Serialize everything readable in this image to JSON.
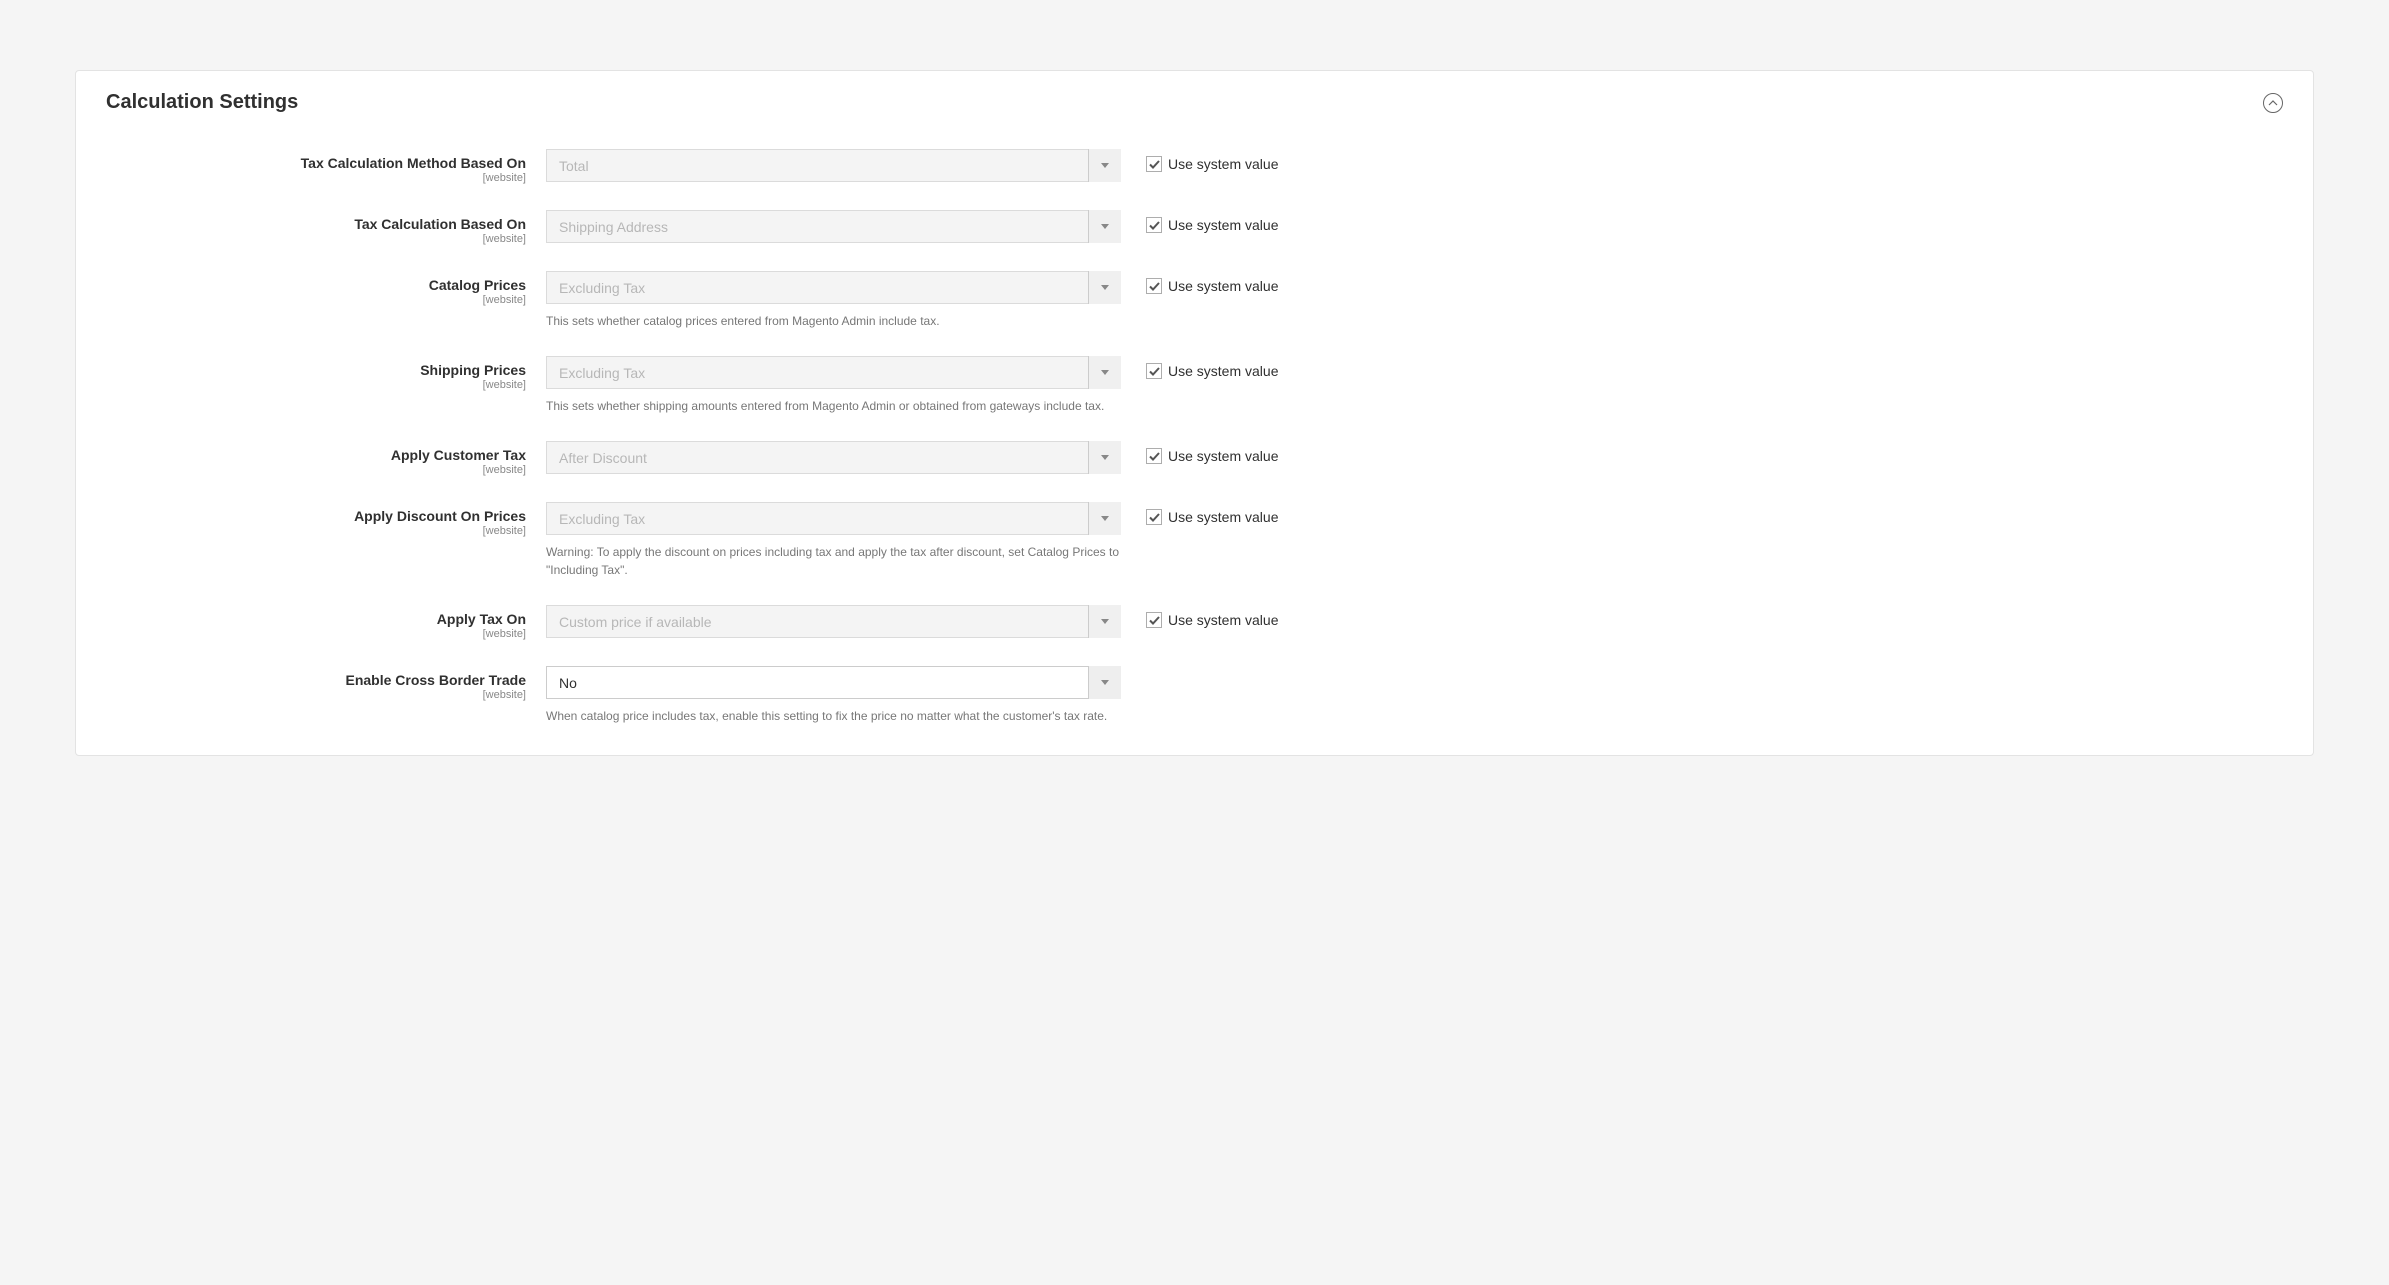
{
  "panel": {
    "title": "Calculation Settings",
    "use_system_value_label": "Use system value"
  },
  "fields": [
    {
      "label": "Tax Calculation Method Based On",
      "scope": "[website]",
      "value": "Total",
      "disabled": true,
      "use_system": true,
      "note": null
    },
    {
      "label": "Tax Calculation Based On",
      "scope": "[website]",
      "value": "Shipping Address",
      "disabled": true,
      "use_system": true,
      "note": null
    },
    {
      "label": "Catalog Prices",
      "scope": "[website]",
      "value": "Excluding Tax",
      "disabled": true,
      "use_system": true,
      "note": "This sets whether catalog prices entered from Magento Admin include tax."
    },
    {
      "label": "Shipping Prices",
      "scope": "[website]",
      "value": "Excluding Tax",
      "disabled": true,
      "use_system": true,
      "note": "This sets whether shipping amounts entered from Magento Admin or obtained from gateways include tax."
    },
    {
      "label": "Apply Customer Tax",
      "scope": "[website]",
      "value": "After Discount",
      "disabled": true,
      "use_system": true,
      "note": null
    },
    {
      "label": "Apply Discount On Prices",
      "scope": "[website]",
      "value": "Excluding Tax",
      "disabled": true,
      "use_system": true,
      "note": "Warning: To apply the discount on prices including tax and apply the tax after discount, set Catalog Prices to \"Including Tax\"."
    },
    {
      "label": "Apply Tax On",
      "scope": "[website]",
      "value": "Custom price if available",
      "disabled": true,
      "use_system": true,
      "note": null
    },
    {
      "label": "Enable Cross Border Trade",
      "scope": "[website]",
      "value": "No",
      "disabled": false,
      "use_system": false,
      "note": "When catalog price includes tax, enable this setting to fix the price no matter what the customer's tax rate."
    }
  ]
}
